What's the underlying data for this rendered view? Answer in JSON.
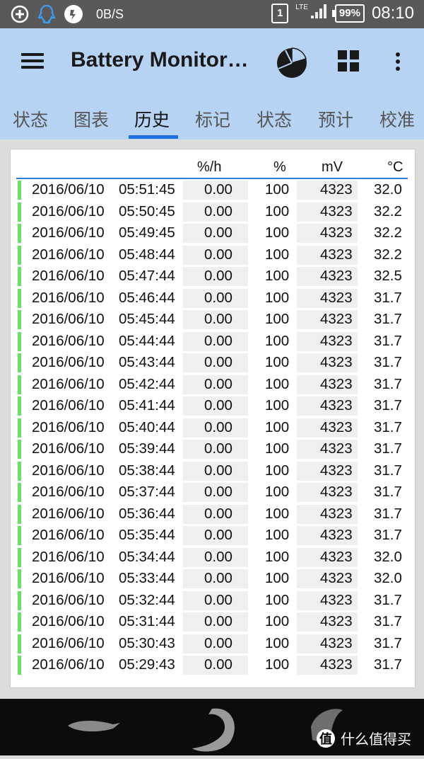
{
  "status_bar": {
    "net_speed": "0B/S",
    "sim": "1",
    "network": "LTE",
    "battery": "99%",
    "time": "08:10"
  },
  "app_bar": {
    "title": "Battery Monitor…"
  },
  "tabs": [
    {
      "label": "状态"
    },
    {
      "label": "图表"
    },
    {
      "label": "历史"
    },
    {
      "label": "标记"
    },
    {
      "label": "状态"
    },
    {
      "label": "预计"
    },
    {
      "label": "校准"
    }
  ],
  "active_tab": "历史",
  "table": {
    "columns": [
      "%/h",
      "%",
      "mV",
      "°C"
    ],
    "rows": [
      {
        "date": "2016/06/10",
        "time": "05:51:45",
        "rate": "0.00",
        "pct": "100",
        "mv": "4323",
        "temp": "32.0"
      },
      {
        "date": "2016/06/10",
        "time": "05:50:45",
        "rate": "0.00",
        "pct": "100",
        "mv": "4323",
        "temp": "32.2"
      },
      {
        "date": "2016/06/10",
        "time": "05:49:45",
        "rate": "0.00",
        "pct": "100",
        "mv": "4323",
        "temp": "32.2"
      },
      {
        "date": "2016/06/10",
        "time": "05:48:44",
        "rate": "0.00",
        "pct": "100",
        "mv": "4323",
        "temp": "32.2"
      },
      {
        "date": "2016/06/10",
        "time": "05:47:44",
        "rate": "0.00",
        "pct": "100",
        "mv": "4323",
        "temp": "32.5"
      },
      {
        "date": "2016/06/10",
        "time": "05:46:44",
        "rate": "0.00",
        "pct": "100",
        "mv": "4323",
        "temp": "31.7"
      },
      {
        "date": "2016/06/10",
        "time": "05:45:44",
        "rate": "0.00",
        "pct": "100",
        "mv": "4323",
        "temp": "31.7"
      },
      {
        "date": "2016/06/10",
        "time": "05:44:44",
        "rate": "0.00",
        "pct": "100",
        "mv": "4323",
        "temp": "31.7"
      },
      {
        "date": "2016/06/10",
        "time": "05:43:44",
        "rate": "0.00",
        "pct": "100",
        "mv": "4323",
        "temp": "31.7"
      },
      {
        "date": "2016/06/10",
        "time": "05:42:44",
        "rate": "0.00",
        "pct": "100",
        "mv": "4323",
        "temp": "31.7"
      },
      {
        "date": "2016/06/10",
        "time": "05:41:44",
        "rate": "0.00",
        "pct": "100",
        "mv": "4323",
        "temp": "31.7"
      },
      {
        "date": "2016/06/10",
        "time": "05:40:44",
        "rate": "0.00",
        "pct": "100",
        "mv": "4323",
        "temp": "31.7"
      },
      {
        "date": "2016/06/10",
        "time": "05:39:44",
        "rate": "0.00",
        "pct": "100",
        "mv": "4323",
        "temp": "31.7"
      },
      {
        "date": "2016/06/10",
        "time": "05:38:44",
        "rate": "0.00",
        "pct": "100",
        "mv": "4323",
        "temp": "31.7"
      },
      {
        "date": "2016/06/10",
        "time": "05:37:44",
        "rate": "0.00",
        "pct": "100",
        "mv": "4323",
        "temp": "31.7"
      },
      {
        "date": "2016/06/10",
        "time": "05:36:44",
        "rate": "0.00",
        "pct": "100",
        "mv": "4323",
        "temp": "31.7"
      },
      {
        "date": "2016/06/10",
        "time": "05:35:44",
        "rate": "0.00",
        "pct": "100",
        "mv": "4323",
        "temp": "31.7"
      },
      {
        "date": "2016/06/10",
        "time": "05:34:44",
        "rate": "0.00",
        "pct": "100",
        "mv": "4323",
        "temp": "32.0"
      },
      {
        "date": "2016/06/10",
        "time": "05:33:44",
        "rate": "0.00",
        "pct": "100",
        "mv": "4323",
        "temp": "32.0"
      },
      {
        "date": "2016/06/10",
        "time": "05:32:44",
        "rate": "0.00",
        "pct": "100",
        "mv": "4323",
        "temp": "31.7"
      },
      {
        "date": "2016/06/10",
        "time": "05:31:44",
        "rate": "0.00",
        "pct": "100",
        "mv": "4323",
        "temp": "31.7"
      },
      {
        "date": "2016/06/10",
        "time": "05:30:43",
        "rate": "0.00",
        "pct": "100",
        "mv": "4323",
        "temp": "31.7"
      },
      {
        "date": "2016/06/10",
        "time": "05:29:43",
        "rate": "0.00",
        "pct": "100",
        "mv": "4323",
        "temp": "31.7"
      }
    ]
  },
  "watermark": {
    "logo": "值",
    "text": "什么值得买"
  },
  "colors": {
    "app_bar": "#b7d3f4",
    "tab_indicator": "#1f6fe0",
    "row_marker": "#6ae06a"
  }
}
